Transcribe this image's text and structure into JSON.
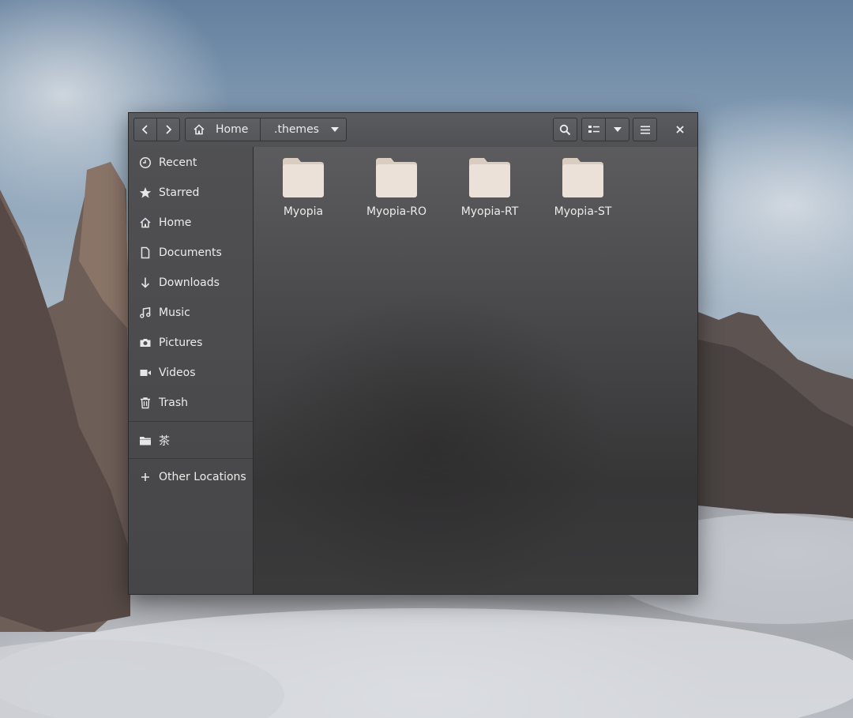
{
  "window": {
    "nav": {
      "back_icon": "chevron-left-icon",
      "forward_icon": "chevron-right-icon"
    },
    "pathbar": {
      "home_icon": "home-icon",
      "home_label": "Home",
      "current_label": ".themes",
      "dropdown_icon": "caret-down-icon"
    },
    "toolbar": {
      "search_icon": "search-icon",
      "view_icon": "list-view-icon",
      "view_options_icon": "caret-down-icon",
      "menu_icon": "hamburger-icon",
      "close_icon": "close-icon"
    },
    "sidebar": {
      "places": [
        {
          "label": "Recent",
          "icon": "clock-icon"
        },
        {
          "label": "Starred",
          "icon": "star-icon"
        },
        {
          "label": "Home",
          "icon": "home-icon"
        },
        {
          "label": "Documents",
          "icon": "document-icon"
        },
        {
          "label": "Downloads",
          "icon": "download-icon"
        },
        {
          "label": "Music",
          "icon": "music-icon"
        },
        {
          "label": "Pictures",
          "icon": "camera-icon"
        },
        {
          "label": "Videos",
          "icon": "video-icon"
        },
        {
          "label": "Trash",
          "icon": "trash-icon"
        }
      ],
      "bookmarks": [
        {
          "label": "茶",
          "icon": "folder-icon"
        }
      ],
      "other": {
        "label": "Other Locations",
        "icon": "plus-icon"
      }
    },
    "files": [
      {
        "name": "Myopia",
        "icon": "folder-icon"
      },
      {
        "name": "Myopia-RO",
        "icon": "folder-icon"
      },
      {
        "name": "Myopia-RT",
        "icon": "folder-icon"
      },
      {
        "name": "Myopia-ST",
        "icon": "folder-icon"
      }
    ],
    "colors": {
      "folder": "#ebe1d8",
      "folder_tab": "#d9cdc2",
      "headerbar": "#555659",
      "content": "#434345"
    }
  }
}
